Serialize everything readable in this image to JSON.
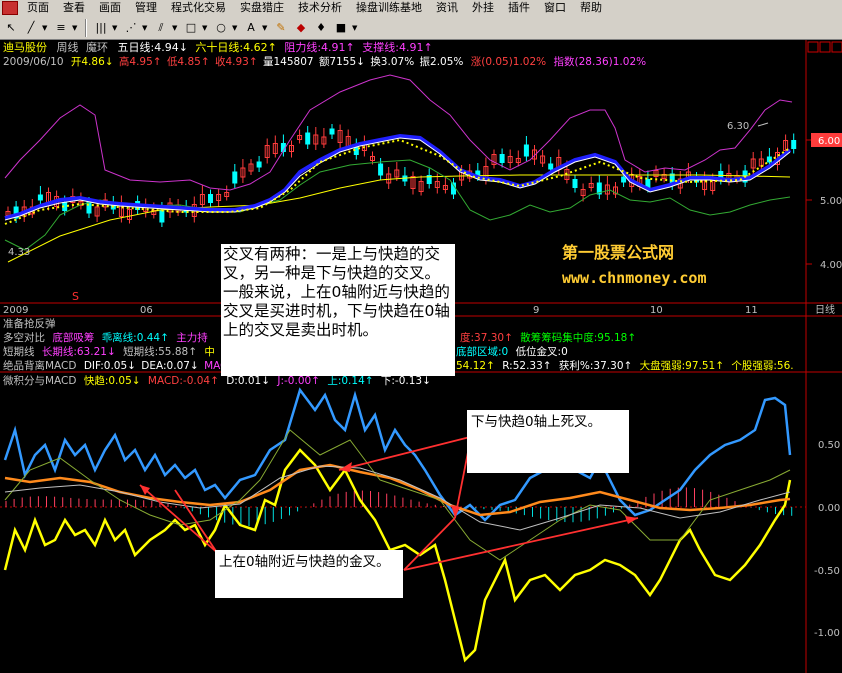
{
  "menu": [
    "页面",
    "查看",
    "画面",
    "管理",
    "程式化交易",
    "实盘猎庄",
    "技术分析",
    "操盘训练基地",
    "资讯",
    "外挂",
    "插件",
    "窗口",
    "帮助"
  ],
  "toolbar_icons": [
    "cursor-icon",
    "line-icon",
    "text-icon",
    "grid-icon",
    "fan-icon",
    "parallel-icon",
    "rect-icon",
    "ellipse-icon",
    "letter-icon",
    "highlight-icon",
    "eraser-icon",
    "mark-icon",
    "save-icon"
  ],
  "header": {
    "stock": "迪马股份",
    "period": "周线",
    "line_name": "魔环",
    "ma5": "五日线:4.94↓",
    "ma60": "六十日线:4.62↑",
    "resist": "阻力线:4.91↑",
    "support": "支撑线:4.91↑",
    "date": "2009/06/10",
    "open": "开4.86↓",
    "high": "高4.95↑",
    "low": "低4.85↑",
    "close": "收4.93↑",
    "volume": "量145807",
    "amount": "额7155↓",
    "turnover": "换3.07%",
    "amplitude": "振2.05%",
    "change": "涨(0.05)1.02%",
    "index": "指数(28.36)1.02%"
  },
  "price_axis": [
    "6.00",
    "5.00",
    "4.00"
  ],
  "price_tags": {
    "high": "6.30",
    "low": "4.33"
  },
  "x_axis": [
    "2009",
    "06",
    "9",
    "10",
    "11"
  ],
  "x_axis_right": "日线",
  "watermark": {
    "line1": "第一股票公式网",
    "line2": "www.chnmoney.com"
  },
  "sub_header": {
    "r1": "准备抢反弹",
    "r2a": "多空对比",
    "r2b": "底部吸筹",
    "r2c": "乖离线:0.44↑",
    "r2d": "主力持",
    "r2e": "度:37.30↑",
    "r2f": "散筹筹码集中度:95.18↑",
    "r3a": "短期线",
    "r3b": "长期线:63.21↓",
    "r3c": "短期线:55.88↑",
    "r3d": "中",
    "r3e": "底部区域:0",
    "r3f": "低位金叉:0",
    "r4a": "绝品背离MACD",
    "r4b": "DIF:0.05↓",
    "r4c": "DEA:0.07↓",
    "r4d": "MACD",
    "r4e": "54.12↑",
    "r4f": "R:52.33↑",
    "r4g": "获利%:37.30↑",
    "r4h": "大盘强弱:97.51↑",
    "r4i": "个股强弱:56.",
    "r5a": "微积分与MACD",
    "r5b": "快趋:0.05↓",
    "r5c": "MACD:-0.04↑",
    "r5d": "D:0.01↓",
    "r5e": "J:-0.00↑",
    "r5f": "上:0.14↑",
    "r5g": "下:-0.13↓"
  },
  "osc_axis": [
    "0.50",
    "0.00",
    "-0.50",
    "-1.00"
  ],
  "notes": {
    "n1": "交叉有两种：一是上与快趋的交叉，另一种是下与快趋的交叉。一般来说，上在0轴附近与快趋的交叉是买进时机，下与快趋在0轴上的交叉是卖出时机。",
    "n2": "下与快趋0轴上死叉。",
    "n3": "上在0轴附近与快趋的金叉。"
  },
  "colors": {
    "bg": "#000000",
    "up": "#ff3c3c",
    "down": "#00ffff",
    "axis": "#c00000",
    "yellow": "#ffff00",
    "blue": "#0000ff",
    "magenta": "#cc33cc",
    "green": "#33aa33"
  }
}
